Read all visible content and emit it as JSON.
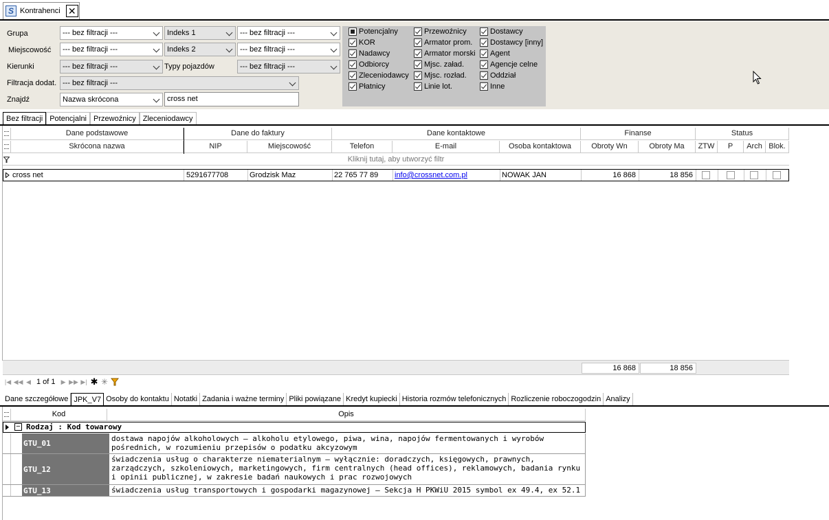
{
  "window_tab": {
    "title": "Kontrahenci",
    "close": "✕"
  },
  "filters": {
    "grupa": {
      "label": "Grupa",
      "value": "--- bez filtracji ---"
    },
    "miejscowosc": {
      "label": "Miejscowość",
      "value": "--- bez filtracji ---"
    },
    "kierunki": {
      "label": "Kierunki",
      "value": "--- bez filtracji ---"
    },
    "filtracja_dodat": {
      "label": "Filtracja dodat.",
      "value": "--- bez filtracji ---"
    },
    "znajdz": {
      "label": "Znajdź",
      "field": "Nazwa skrócona",
      "value": "cross net"
    },
    "indeks1": {
      "label": "Indeks 1",
      "value": "--- bez filtracji ---"
    },
    "indeks2": {
      "label": "Indeks 2",
      "value": "--- bez filtracji ---"
    },
    "typy_pojazdow": {
      "label": "Typy pojazdów",
      "value": "--- bez filtracji ---"
    }
  },
  "checkboxes": {
    "col1": [
      {
        "label": "Potencjalny",
        "state": "indeterminate"
      },
      {
        "label": "KOR",
        "state": "checked"
      },
      {
        "label": "Nadawcy",
        "state": "checked"
      },
      {
        "label": "Odbiorcy",
        "state": "checked"
      },
      {
        "label": "Zleceniodawcy",
        "state": "checked"
      },
      {
        "label": "Płatnicy",
        "state": "checked"
      }
    ],
    "col2": [
      {
        "label": "Przewoźnicy",
        "state": "checked"
      },
      {
        "label": "Armator prom.",
        "state": "checked"
      },
      {
        "label": "Armator morski",
        "state": "checked"
      },
      {
        "label": "Mjsc. załad.",
        "state": "checked"
      },
      {
        "label": "Mjsc. rozład.",
        "state": "checked"
      },
      {
        "label": "Linie lot.",
        "state": "checked"
      }
    ],
    "col3": [
      {
        "label": "Dostawcy",
        "state": "checked"
      },
      {
        "label": "Dostawcy [inny]",
        "state": "checked"
      },
      {
        "label": "Agent",
        "state": "checked"
      },
      {
        "label": "Agencje celne",
        "state": "checked"
      },
      {
        "label": "Oddział",
        "state": "checked"
      },
      {
        "label": "Inne",
        "state": "checked"
      }
    ]
  },
  "filter_tabs": [
    "Bez filtracji",
    "Potencjalni",
    "Przewoźnicy",
    "Zleceniodawcy"
  ],
  "grid": {
    "groups": [
      "Dane podstawowe",
      "Dane do faktury",
      "Dane kontaktowe",
      "Finanse",
      "Status"
    ],
    "columns": [
      "Skrócona nazwa",
      "NIP",
      "Miejscowość",
      "Telefon",
      "E-mail",
      "Osoba kontaktowa",
      "Obroty Wn",
      "Obroty Ma",
      "ZTW",
      "P",
      "Arch",
      "Blok."
    ],
    "filter_hint": "Kliknij tutaj, aby utworzyć filtr",
    "row": {
      "nazwa": "cross net",
      "nip": "5291677708",
      "miejscowosc": "Grodzisk Maz",
      "telefon": "22 765 77 89",
      "email": "info@crossnet.com.pl",
      "osoba": "NOWAK JAN",
      "obroty_wn": "16 868",
      "obroty_ma": "18 856"
    },
    "summary": {
      "wn": "16 868",
      "ma": "18 856"
    }
  },
  "navigator": {
    "page": "1 of 1"
  },
  "bottom_tabs": [
    "Dane szczegółowe",
    "JPK_V7",
    "Osoby do kontaktu",
    "Notatki",
    "Zadania i ważne terminy",
    "Pliki powiązane",
    "Kredyt kupiecki",
    "Historia rozmów telefonicznych",
    "Rozliczenie roboczogodzin",
    "Analizy"
  ],
  "codes_grid": {
    "columns": [
      "Kod",
      "Opis"
    ],
    "group": "Rodzaj : Kod towarowy",
    "rows": [
      {
        "kod": "GTU_01",
        "opis": "dostawa napojów alkoholowych – alkoholu etylowego, piwa, wina, napojów fermentowanych i wyrobów pośrednich, w rozumieniu przepisów o podatku akcyzowym"
      },
      {
        "kod": "GTU_12",
        "opis": "świadczenia usług o charakterze niematerialnym – wyłącznie: doradczych, księgowych, prawnych, zarządczych, szkoleniowych, marketingowych, firm centralnych (head offices), reklamowych, badania rynku i opinii publicznej, w zakresie badań naukowych i prac rozwojowych"
      },
      {
        "kod": "GTU_13",
        "opis": "świadczenia usług transportowych i gospodarki magazynowej – Sekcja H PKWiU 2015 symbol ex 49.4, ex 52.1"
      }
    ]
  },
  "icons": {
    "app": "app-icon",
    "close": "close-icon",
    "dropdown": "chevron-down-icon",
    "cursor": "mouse-pointer-icon"
  }
}
